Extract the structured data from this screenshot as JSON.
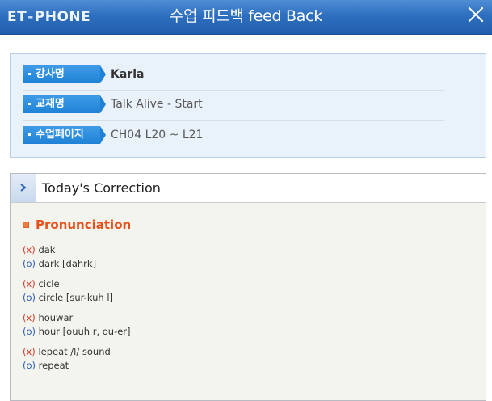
{
  "app": {
    "logo_left": "ET",
    "logo_dash": "-",
    "logo_right": "PHONE",
    "title": "수업 피드백 feed Back"
  },
  "info": {
    "rows": [
      {
        "label": "강사명",
        "value": "Karla"
      },
      {
        "label": "교재명",
        "value": "Talk Alive - Start"
      },
      {
        "label": "수업페이지",
        "value": "CH04 L20 ~ L21"
      }
    ]
  },
  "correction": {
    "title": "Today's Correction",
    "section": "Pronunciation",
    "wrong_mark": "(x)",
    "right_mark": "(o)",
    "items": [
      {
        "wrong": "dak",
        "right": "dark [dahrk]"
      },
      {
        "wrong": "cicle",
        "right": "circle [sur-kuh l]"
      },
      {
        "wrong": "houwar",
        "right": "hour [ouuh r, ou-er]"
      },
      {
        "wrong": "lepeat /l/ sound",
        "right": "repeat"
      }
    ]
  },
  "colors": {
    "titlebar": "#2e6fbf",
    "tag": "#1f82d6",
    "section_title": "#e8501a",
    "wrong": "#d23a2a",
    "right": "#2a5bb8"
  },
  "icons": [
    "close-icon",
    "chevron-right-icon",
    "bullet-square-icon"
  ]
}
